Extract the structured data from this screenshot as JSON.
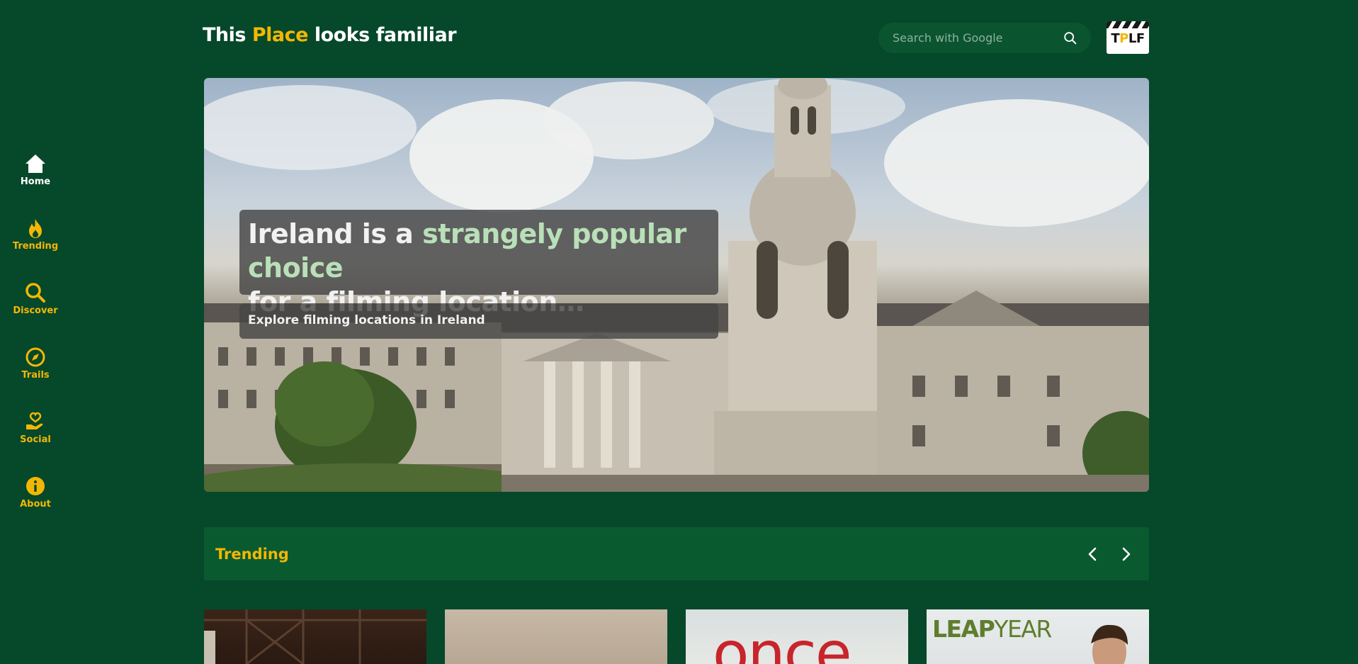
{
  "header": {
    "title_part1": "This ",
    "title_accent": "Place",
    "title_part2": " looks familiar",
    "search_placeholder": "Search with Google",
    "logo_text_a": "T",
    "logo_text_b": "P",
    "logo_text_c": "LF"
  },
  "sidebar": {
    "items": [
      {
        "label": "Home",
        "icon": "home-icon",
        "active": true
      },
      {
        "label": "Trending",
        "icon": "flame-icon",
        "active": false
      },
      {
        "label": "Discover",
        "icon": "search-icon",
        "active": false
      },
      {
        "label": "Trails",
        "icon": "compass-icon",
        "active": false
      },
      {
        "label": "Social",
        "icon": "heart-hand-icon",
        "active": false
      },
      {
        "label": "About",
        "icon": "info-icon",
        "active": false
      }
    ]
  },
  "hero": {
    "title_a": "Ireland is a ",
    "title_highlight": "strangely popular choice",
    "title_b": "for a filming location…",
    "subtitle": "Explore filming locations in Ireland"
  },
  "trending": {
    "title": "Trending",
    "cards": [
      {
        "kind": "photo-dark"
      },
      {
        "kind": "photo-beige"
      },
      {
        "kind": "poster",
        "text": "once"
      },
      {
        "kind": "poster",
        "text_a": "LEAP",
        "text_b": "YEAR"
      }
    ]
  },
  "colors": {
    "background": "#06482a",
    "accent": "#f2b705",
    "highlight": "#b9e0b8",
    "bar": "#0a5a30"
  }
}
